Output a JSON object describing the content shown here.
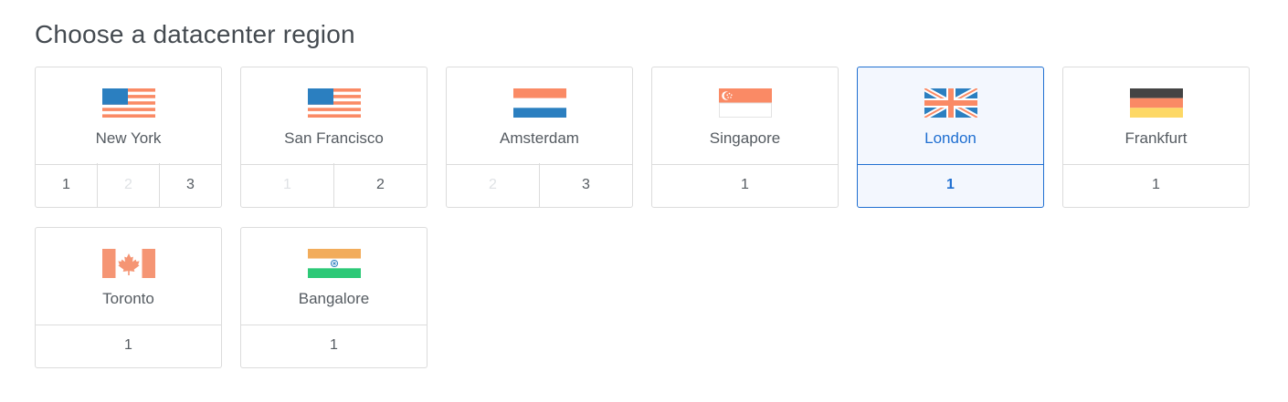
{
  "page": {
    "title": "Choose a datacenter region"
  },
  "regions": [
    {
      "name": "New York",
      "flag": "us-flag-icon",
      "datacenters": [
        "1",
        "2",
        "3"
      ],
      "disabled": [
        false,
        true,
        false
      ],
      "selected": false
    },
    {
      "name": "San Francisco",
      "flag": "us-flag-icon",
      "datacenters": [
        "1",
        "2"
      ],
      "disabled": [
        true,
        false
      ],
      "selected": false
    },
    {
      "name": "Amsterdam",
      "flag": "netherlands-flag-icon",
      "datacenters": [
        "2",
        "3"
      ],
      "disabled": [
        true,
        false
      ],
      "selected": false
    },
    {
      "name": "Singapore",
      "flag": "singapore-flag-icon",
      "datacenters": [
        "1"
      ],
      "disabled": [
        false
      ],
      "selected": false
    },
    {
      "name": "London",
      "flag": "uk-flag-icon",
      "datacenters": [
        "1"
      ],
      "disabled": [
        false
      ],
      "selected": true
    },
    {
      "name": "Frankfurt",
      "flag": "germany-flag-icon",
      "datacenters": [
        "1"
      ],
      "disabled": [
        false
      ],
      "selected": false
    },
    {
      "name": "Toronto",
      "flag": "canada-flag-icon",
      "datacenters": [
        "1"
      ],
      "disabled": [
        false
      ],
      "selected": false
    },
    {
      "name": "Bangalore",
      "flag": "india-flag-icon",
      "datacenters": [
        "1"
      ],
      "disabled": [
        false
      ],
      "selected": false
    }
  ],
  "colors": {
    "accent": "#1f6fd1",
    "flag_blue": "#2b7fc0",
    "flag_red": "#fa8a65",
    "flag_black": "#444444",
    "flag_yellow": "#fdd865",
    "flag_green": "#2dc977",
    "flag_saffron": "#f2ac5b"
  }
}
